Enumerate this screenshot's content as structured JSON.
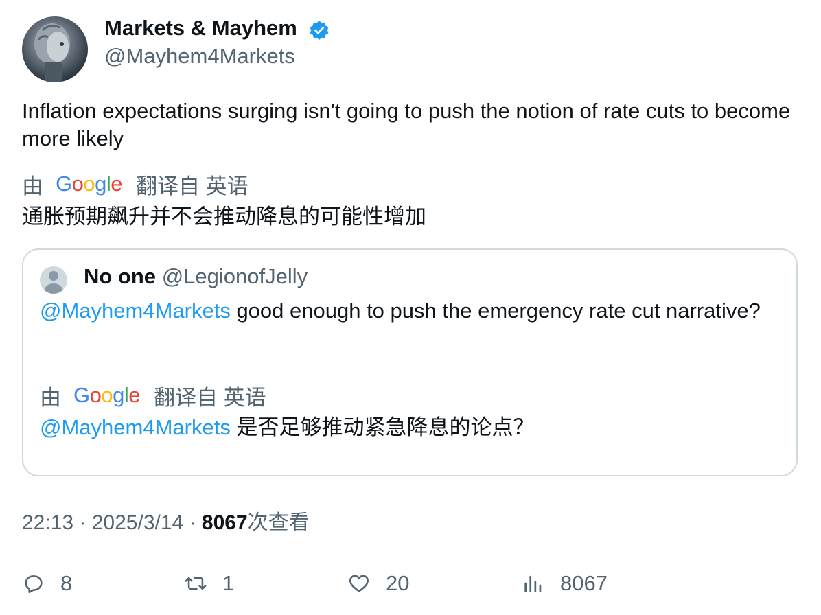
{
  "author": {
    "display_name": "Markets & Mayhem",
    "handle": "@Mayhem4Markets",
    "verified": true
  },
  "tweet": {
    "text": "Inflation expectations surging isn't going to push the notion of rate cuts to become more likely",
    "translation": {
      "by": "由",
      "provider": "Google",
      "from": "翻译自 英语",
      "text": "通胀预期飙升并不会推动降息的可能性增加"
    }
  },
  "quote": {
    "display_name": "No one",
    "handle": "@LegionofJelly",
    "mention": "@Mayhem4Markets",
    "text": " good enough to push the emergency rate cut narrative?",
    "translation": {
      "by": "由",
      "provider": "Google",
      "from": "翻译自 英语",
      "mention": "@Mayhem4Markets",
      "text": " 是否足够推动紧急降息的论点？"
    }
  },
  "meta": {
    "time": "22:13",
    "sep1": " · ",
    "date": "2025/3/14",
    "sep2": " · ",
    "views_count": "8067",
    "views_label": "次查看"
  },
  "actions": {
    "replies": "8",
    "retweets": "1",
    "likes": "20",
    "views": "8067"
  },
  "colors": {
    "accent": "#1d9bf0",
    "muted": "#536471",
    "text": "#0f1419",
    "border": "#cfd9de"
  }
}
